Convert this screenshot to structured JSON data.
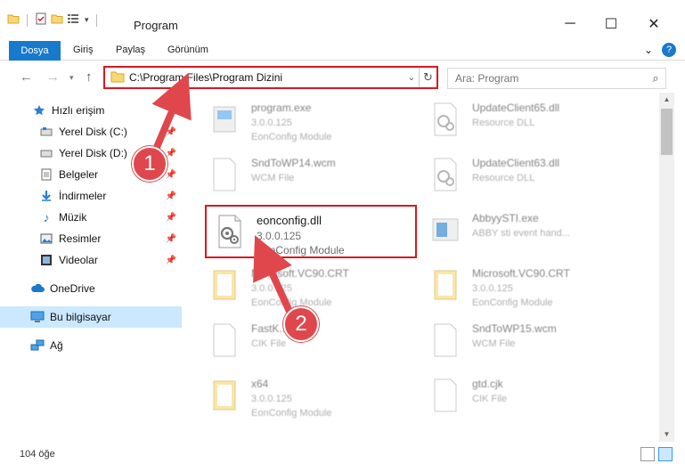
{
  "window": {
    "title": "Program",
    "minimize_glyph": "─",
    "maximize_glyph": "☐",
    "close_glyph": "✕"
  },
  "ribbon": {
    "tabs": [
      "Dosya",
      "Giriş",
      "Paylaş",
      "Görünüm"
    ],
    "expand_glyph": "⌄",
    "help_glyph": "?"
  },
  "address": {
    "path": "C:\\Program Files\\Program Dizini",
    "search_placeholder": "Ara: Program"
  },
  "nav_pane": {
    "quick_access": "Hızlı erişim",
    "items": [
      {
        "label": "Yerel Disk (C:)",
        "icon": "drive-icon"
      },
      {
        "label": "Yerel Disk (D:)",
        "icon": "drive-icon"
      },
      {
        "label": "Belgeler",
        "icon": "documents-icon"
      },
      {
        "label": "İndirmeler",
        "icon": "download-icon"
      },
      {
        "label": "Müzik",
        "icon": "music-icon"
      },
      {
        "label": "Resimler",
        "icon": "pictures-icon"
      },
      {
        "label": "Videolar",
        "icon": "video-icon"
      }
    ],
    "onedrive": "OneDrive",
    "this_pc": "Bu bilgisayar",
    "network": "Ağ"
  },
  "files": [
    {
      "name": "program.exe",
      "line2": "3.0.0.125",
      "line3": "EonConfig Module",
      "icon": "exe-icon"
    },
    {
      "name": "UpdateClient65.dll",
      "line2": "Resource DLL",
      "line3": "",
      "icon": "dll-icon"
    },
    {
      "name": "SndToWP14.wcm",
      "line2": "WCM File",
      "line3": "",
      "icon": "generic-file-icon"
    },
    {
      "name": "UpdateClient63.dll",
      "line2": "Resource DLL",
      "line3": "",
      "icon": "dll-icon"
    },
    {
      "name": "eonconfig.dll",
      "line2": "3.0.0.125",
      "line3": "EonConfig Module",
      "icon": "dll-icon"
    },
    {
      "name": "AbbyySTI.exe",
      "line2": "ABBY sti event hand...",
      "line3": "",
      "icon": "exe-icon"
    },
    {
      "name": "Microsoft.VC90.CRT",
      "line2": "3.0.0.125",
      "line3": "EonConfig Module",
      "icon": "manifest-icon"
    },
    {
      "name": "Microsoft.VC90.CRT",
      "line2": "3.0.0.125",
      "line3": "EonConfig Module",
      "icon": "manifest-icon"
    },
    {
      "name": "FastK...",
      "line2": "CIK File",
      "line3": "",
      "icon": "generic-file-icon"
    },
    {
      "name": "SndToWP15.wcm",
      "line2": "WCM File",
      "line3": "",
      "icon": "generic-file-icon"
    },
    {
      "name": "x64",
      "line2": "3.0.0.125",
      "line3": "EonConfig Module",
      "icon": "manifest-icon"
    },
    {
      "name": "gtd.cjk",
      "line2": "CIK File",
      "line3": "",
      "icon": "generic-file-icon"
    }
  ],
  "status": {
    "item_count": "104 öğe"
  },
  "annotations": {
    "badge1": "1",
    "badge2": "2"
  },
  "colors": {
    "accent": "#1979ca",
    "highlight_red": "#d71920",
    "badge_red": "#e0474c",
    "selected": "#cce8ff"
  }
}
